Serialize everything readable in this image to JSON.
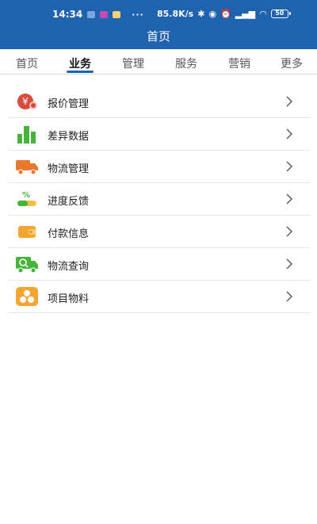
{
  "status_bar": {
    "time": "14:34",
    "dots": "···",
    "net_speed": "85.8K/s",
    "battery": "50"
  },
  "header": {
    "title": "首页"
  },
  "tabs": [
    {
      "label": "首页",
      "active": false
    },
    {
      "label": "业务",
      "active": true
    },
    {
      "label": "管理",
      "active": false
    },
    {
      "label": "服务",
      "active": false
    },
    {
      "label": "营销",
      "active": false
    },
    {
      "label": "更多",
      "active": false
    }
  ],
  "menu": [
    {
      "label": "报价管理",
      "icon": "quote-icon"
    },
    {
      "label": "差异数据",
      "icon": "bar-chart-icon"
    },
    {
      "label": "物流管理",
      "icon": "truck-icon"
    },
    {
      "label": "进度反馈",
      "icon": "progress-icon"
    },
    {
      "label": "付款信息",
      "icon": "wallet-icon"
    },
    {
      "label": "物流查询",
      "icon": "truck-search-icon"
    },
    {
      "label": "项目物料",
      "icon": "materials-icon"
    }
  ],
  "colors": {
    "header_bg": "#1f62ad",
    "tab_underline": "#1f62ad",
    "icon_red": "#d94a3f",
    "icon_green": "#46b43b",
    "icon_orange": "#e8782c",
    "icon_yellow": "#f2a532"
  }
}
